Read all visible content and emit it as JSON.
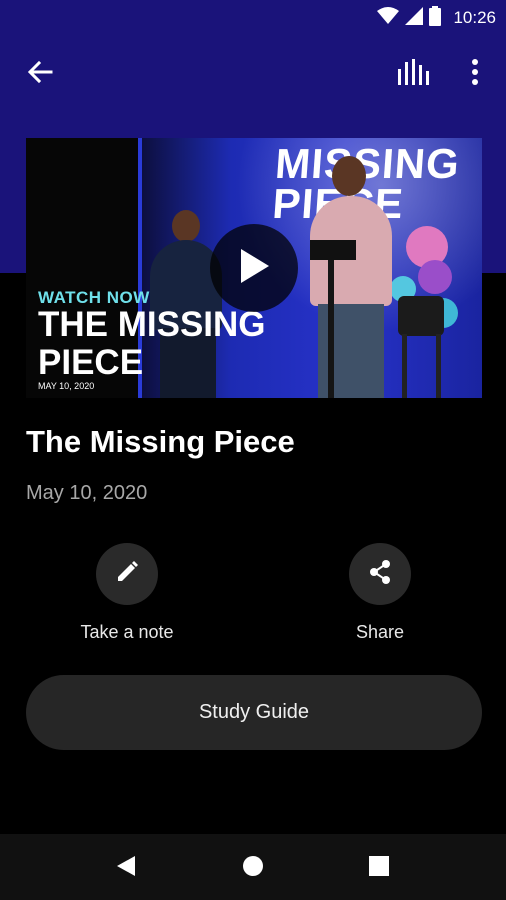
{
  "status_bar": {
    "time": "10:26"
  },
  "toolbar": {
    "back_icon": "arrow-back-icon",
    "bars_icon": "audio-bars-icon",
    "more_icon": "more-vert-icon",
    "background_color": "#1a137a"
  },
  "video": {
    "backdrop_text": "MISSING PIECE",
    "watch_now": "WATCH NOW",
    "overlay_title": "THE MISSING PIECE",
    "overlay_date": "MAY 10, 2020",
    "play_icon": "play-icon"
  },
  "sermon": {
    "title": "The Missing Piece",
    "date": "May 10, 2020"
  },
  "actions": [
    {
      "label": "Take a note",
      "icon": "pencil-icon"
    },
    {
      "label": "Share",
      "icon": "share-icon"
    }
  ],
  "study_guide": {
    "label": "Study Guide"
  },
  "nav": {
    "back_icon": "nav-back-icon",
    "home_icon": "nav-home-icon",
    "recents_icon": "nav-recents-icon"
  }
}
